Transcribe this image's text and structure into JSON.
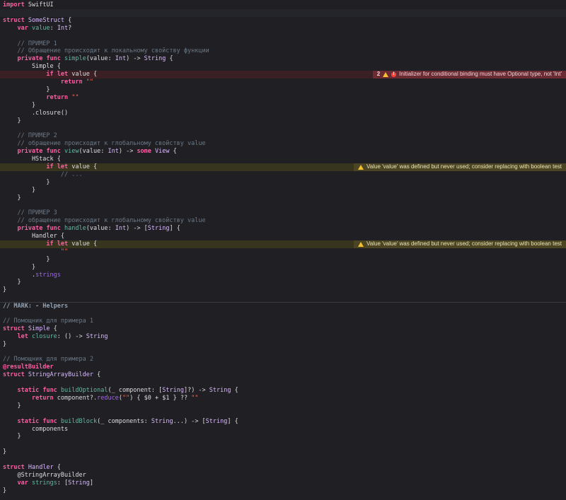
{
  "colors": {
    "background": "#1f1f24",
    "keyword": "#fc5fa3",
    "type": "#dabaff",
    "comment": "#6c7986",
    "string": "#fc6a5d",
    "error_bar": "#6b2b33",
    "warning_bar": "#4b4524"
  },
  "code": [
    [
      {
        "c": "kw",
        "t": "import"
      },
      {
        "c": "plain",
        "t": " SwiftUI"
      }
    ],
    [],
    [
      {
        "c": "kw",
        "t": "struct"
      },
      {
        "c": "plain",
        "t": " "
      },
      {
        "c": "type",
        "t": "SomeStruct"
      },
      {
        "c": "plain",
        "t": " {"
      }
    ],
    [
      {
        "c": "plain",
        "t": "    "
      },
      {
        "c": "kw",
        "t": "var"
      },
      {
        "c": "plain",
        "t": " "
      },
      {
        "c": "ident",
        "t": "value"
      },
      {
        "c": "plain",
        "t": ": "
      },
      {
        "c": "type",
        "t": "Int"
      },
      {
        "c": "plain",
        "t": "?"
      }
    ],
    [],
    [
      {
        "c": "cm",
        "t": "    // ПРИМЕР 1"
      }
    ],
    [
      {
        "c": "cm",
        "t": "    // Обращение происходит к локальному свойству функции"
      }
    ],
    [
      {
        "c": "plain",
        "t": "    "
      },
      {
        "c": "kw",
        "t": "private"
      },
      {
        "c": "plain",
        "t": " "
      },
      {
        "c": "kw",
        "t": "func"
      },
      {
        "c": "plain",
        "t": " "
      },
      {
        "c": "func",
        "t": "simple"
      },
      {
        "c": "plain",
        "t": "(value: "
      },
      {
        "c": "type",
        "t": "Int"
      },
      {
        "c": "plain",
        "t": ") -> "
      },
      {
        "c": "type",
        "t": "String"
      },
      {
        "c": "plain",
        "t": " {"
      }
    ],
    [
      {
        "c": "plain",
        "t": "        Simple {"
      }
    ],
    [
      {
        "c": "plain",
        "t": "            "
      },
      {
        "c": "kw",
        "t": "if"
      },
      {
        "c": "plain",
        "t": " "
      },
      {
        "c": "kw",
        "t": "let"
      },
      {
        "c": "plain",
        "t": " value {"
      }
    ],
    [
      {
        "c": "plain",
        "t": "                "
      },
      {
        "c": "kw",
        "t": "return"
      },
      {
        "c": "plain",
        "t": " "
      },
      {
        "c": "str",
        "t": "\"\""
      }
    ],
    [
      {
        "c": "plain",
        "t": "            }"
      }
    ],
    [
      {
        "c": "plain",
        "t": "            "
      },
      {
        "c": "kw",
        "t": "return"
      },
      {
        "c": "plain",
        "t": " "
      },
      {
        "c": "str",
        "t": "\"\""
      }
    ],
    [
      {
        "c": "plain",
        "t": "        }"
      }
    ],
    [
      {
        "c": "plain",
        "t": "        .closure()"
      }
    ],
    [
      {
        "c": "plain",
        "t": "    }"
      }
    ],
    [],
    [
      {
        "c": "cm",
        "t": "    // ПРИМЕР 2"
      }
    ],
    [
      {
        "c": "cm",
        "t": "    // обращение происходит к глобальному свойству value"
      }
    ],
    [
      {
        "c": "plain",
        "t": "    "
      },
      {
        "c": "kw",
        "t": "private"
      },
      {
        "c": "plain",
        "t": " "
      },
      {
        "c": "kw",
        "t": "func"
      },
      {
        "c": "plain",
        "t": " "
      },
      {
        "c": "func",
        "t": "view"
      },
      {
        "c": "plain",
        "t": "(value: "
      },
      {
        "c": "type",
        "t": "Int"
      },
      {
        "c": "plain",
        "t": ") -> "
      },
      {
        "c": "kw",
        "t": "some"
      },
      {
        "c": "plain",
        "t": " "
      },
      {
        "c": "type",
        "t": "View"
      },
      {
        "c": "plain",
        "t": " {"
      }
    ],
    [
      {
        "c": "plain",
        "t": "        HStack {"
      }
    ],
    [
      {
        "c": "plain",
        "t": "            "
      },
      {
        "c": "kw",
        "t": "if"
      },
      {
        "c": "plain",
        "t": " "
      },
      {
        "c": "kw",
        "t": "let"
      },
      {
        "c": "plain",
        "t": " value {"
      }
    ],
    [
      {
        "c": "cm",
        "t": "                // ..."
      }
    ],
    [
      {
        "c": "plain",
        "t": "            }"
      }
    ],
    [
      {
        "c": "plain",
        "t": "        }"
      }
    ],
    [
      {
        "c": "plain",
        "t": "    }"
      }
    ],
    [],
    [
      {
        "c": "cm",
        "t": "    // ПРИМЕР 3"
      }
    ],
    [
      {
        "c": "cm",
        "t": "    // обращение происходит к глобальному свойству value"
      }
    ],
    [
      {
        "c": "plain",
        "t": "    "
      },
      {
        "c": "kw",
        "t": "private"
      },
      {
        "c": "plain",
        "t": " "
      },
      {
        "c": "kw",
        "t": "func"
      },
      {
        "c": "plain",
        "t": " "
      },
      {
        "c": "func",
        "t": "handle"
      },
      {
        "c": "plain",
        "t": "(value: "
      },
      {
        "c": "type",
        "t": "Int"
      },
      {
        "c": "plain",
        "t": ") -> ["
      },
      {
        "c": "type",
        "t": "String"
      },
      {
        "c": "plain",
        "t": "] {"
      }
    ],
    [
      {
        "c": "plain",
        "t": "        Handler {"
      }
    ],
    [
      {
        "c": "plain",
        "t": "            "
      },
      {
        "c": "kw",
        "t": "if"
      },
      {
        "c": "plain",
        "t": " "
      },
      {
        "c": "kw",
        "t": "let"
      },
      {
        "c": "plain",
        "t": " value {"
      }
    ],
    [
      {
        "c": "plain",
        "t": "                "
      },
      {
        "c": "str",
        "t": "\"\""
      }
    ],
    [
      {
        "c": "plain",
        "t": "            }"
      }
    ],
    [
      {
        "c": "plain",
        "t": "        }"
      }
    ],
    [
      {
        "c": "plain",
        "t": "        ."
      },
      {
        "c": "member",
        "t": "strings"
      }
    ],
    [
      {
        "c": "plain",
        "t": "    }"
      }
    ],
    [
      {
        "c": "plain",
        "t": "}"
      }
    ],
    [],
    [
      {
        "c": "mark",
        "t": "// MARK: - Helpers"
      }
    ],
    [],
    [
      {
        "c": "cm",
        "t": "// Помощник для примера 1"
      }
    ],
    [
      {
        "c": "kw",
        "t": "struct"
      },
      {
        "c": "plain",
        "t": " "
      },
      {
        "c": "type",
        "t": "Simple"
      },
      {
        "c": "plain",
        "t": " {"
      }
    ],
    [
      {
        "c": "plain",
        "t": "    "
      },
      {
        "c": "kw",
        "t": "let"
      },
      {
        "c": "plain",
        "t": " "
      },
      {
        "c": "ident",
        "t": "closure"
      },
      {
        "c": "plain",
        "t": ": () -> "
      },
      {
        "c": "type",
        "t": "String"
      }
    ],
    [
      {
        "c": "plain",
        "t": "}"
      }
    ],
    [],
    [
      {
        "c": "cm",
        "t": "// Помощник для примера 2"
      }
    ],
    [
      {
        "c": "kw",
        "t": "@resultBuilder"
      }
    ],
    [
      {
        "c": "kw",
        "t": "struct"
      },
      {
        "c": "plain",
        "t": " "
      },
      {
        "c": "type",
        "t": "StringArrayBuilder"
      },
      {
        "c": "plain",
        "t": " {"
      }
    ],
    [],
    [
      {
        "c": "plain",
        "t": "    "
      },
      {
        "c": "kw",
        "t": "static"
      },
      {
        "c": "plain",
        "t": " "
      },
      {
        "c": "kw",
        "t": "func"
      },
      {
        "c": "plain",
        "t": " "
      },
      {
        "c": "func",
        "t": "buildOptional"
      },
      {
        "c": "plain",
        "t": "(_ component: ["
      },
      {
        "c": "type",
        "t": "String"
      },
      {
        "c": "plain",
        "t": "]?) -> "
      },
      {
        "c": "type",
        "t": "String"
      },
      {
        "c": "plain",
        "t": " {"
      }
    ],
    [
      {
        "c": "plain",
        "t": "        "
      },
      {
        "c": "kw",
        "t": "return"
      },
      {
        "c": "plain",
        "t": " component?."
      },
      {
        "c": "member",
        "t": "reduce"
      },
      {
        "c": "plain",
        "t": "("
      },
      {
        "c": "str",
        "t": "\"\""
      },
      {
        "c": "plain",
        "t": ") { $0 + $1 } ?? "
      },
      {
        "c": "str",
        "t": "\"\""
      }
    ],
    [
      {
        "c": "plain",
        "t": "    }"
      }
    ],
    [],
    [
      {
        "c": "plain",
        "t": "    "
      },
      {
        "c": "kw",
        "t": "static"
      },
      {
        "c": "plain",
        "t": " "
      },
      {
        "c": "kw",
        "t": "func"
      },
      {
        "c": "plain",
        "t": " "
      },
      {
        "c": "func",
        "t": "buildBlock"
      },
      {
        "c": "plain",
        "t": "(_ components: "
      },
      {
        "c": "type",
        "t": "String"
      },
      {
        "c": "plain",
        "t": "...) -> ["
      },
      {
        "c": "type",
        "t": "String"
      },
      {
        "c": "plain",
        "t": "] {"
      }
    ],
    [
      {
        "c": "plain",
        "t": "        components"
      }
    ],
    [
      {
        "c": "plain",
        "t": "    }"
      }
    ],
    [],
    [
      {
        "c": "plain",
        "t": "}"
      }
    ],
    [],
    [
      {
        "c": "kw",
        "t": "struct"
      },
      {
        "c": "plain",
        "t": " "
      },
      {
        "c": "type",
        "t": "Handler"
      },
      {
        "c": "plain",
        "t": " {"
      }
    ],
    [
      {
        "c": "plain",
        "t": "    @StringArrayBuilder"
      }
    ],
    [
      {
        "c": "plain",
        "t": "    "
      },
      {
        "c": "kw",
        "t": "var"
      },
      {
        "c": "plain",
        "t": " "
      },
      {
        "c": "ident",
        "t": "strings"
      },
      {
        "c": "plain",
        "t": ": ["
      },
      {
        "c": "type",
        "t": "String"
      },
      {
        "c": "plain",
        "t": "]"
      }
    ],
    [
      {
        "c": "plain",
        "t": "}"
      }
    ]
  ],
  "diagnostics": {
    "error": {
      "count": "2",
      "message": "Initializer for conditional binding must have Optional type, not 'Int'"
    },
    "warning_view": {
      "message": "Value 'value' was defined but never used; consider replacing with boolean test"
    },
    "warning_handle": {
      "message": "Value 'value' was defined but never used; consider replacing with boolean test"
    }
  }
}
